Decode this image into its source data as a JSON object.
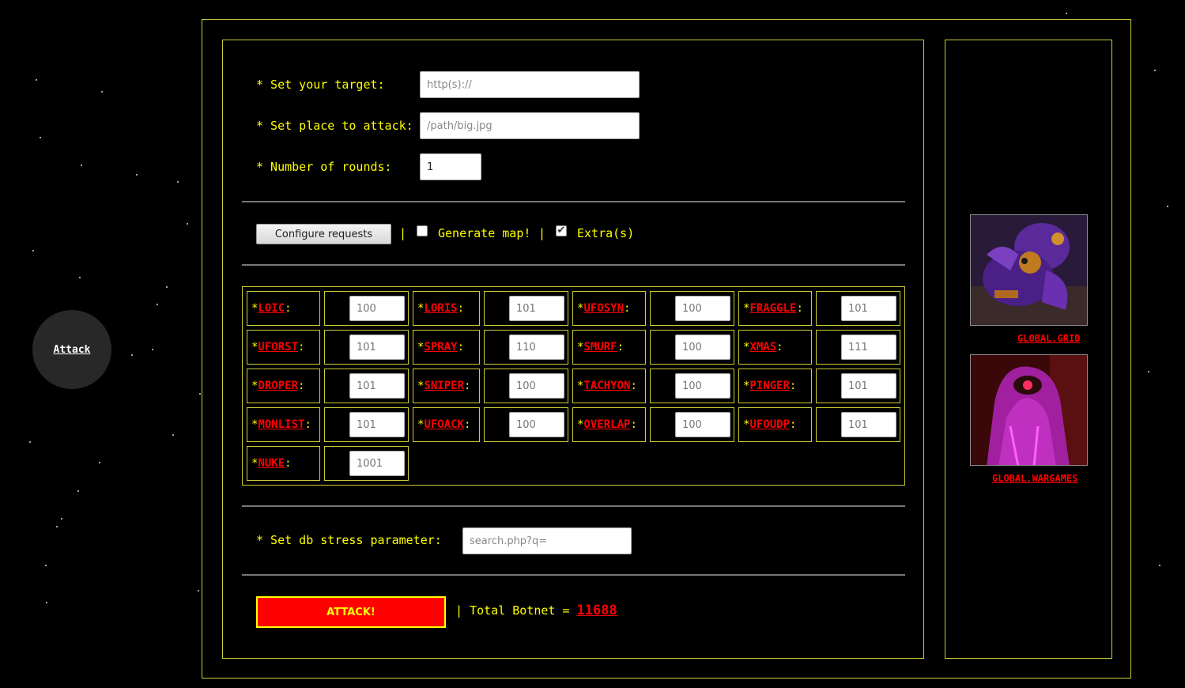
{
  "nav": {
    "attack_label": "Attack"
  },
  "form": {
    "target_label": "* Set your target:",
    "target_placeholder": "http(s)://",
    "place_label": "* Set place to attack:",
    "place_placeholder": "/path/big.jpg",
    "rounds_label": "* Number of rounds:",
    "rounds_value": "1"
  },
  "options": {
    "configure_label": "Configure requests",
    "separator": "|",
    "generate_map_label": "Generate map!",
    "generate_map_checked": false,
    "extras_label": "Extra(s)",
    "extras_checked": true
  },
  "extras": [
    {
      "name": "LOIC",
      "value": "100"
    },
    {
      "name": "LORIS",
      "value": "101"
    },
    {
      "name": "UFOSYN",
      "value": "100"
    },
    {
      "name": "FRAGGLE",
      "value": "101"
    },
    {
      "name": "UFORST",
      "value": "101"
    },
    {
      "name": "SPRAY",
      "value": "110"
    },
    {
      "name": "SMURF",
      "value": "100"
    },
    {
      "name": "XMAS",
      "value": "111"
    },
    {
      "name": "DROPER",
      "value": "101"
    },
    {
      "name": "SNIPER",
      "value": "100"
    },
    {
      "name": "TACHYON",
      "value": "100"
    },
    {
      "name": "PINGER",
      "value": "101"
    },
    {
      "name": "MONLIST",
      "value": "101"
    },
    {
      "name": "UFOACK",
      "value": "100"
    },
    {
      "name": "OVERLAP",
      "value": "100"
    },
    {
      "name": "UFOUDP",
      "value": "101"
    },
    {
      "name": "NUKE",
      "value": "1001"
    }
  ],
  "db_stress": {
    "label": "* Set db stress parameter:",
    "placeholder": "search.php?q="
  },
  "attack": {
    "button_label": "ATTACK!",
    "total_prefix": "| Total Botnet =",
    "total_value": "11688"
  },
  "side": {
    "grid_label": "GLOBAL.GRID",
    "wargames_label": "GLOBAL.WARGAMES"
  },
  "colors": {
    "accent": "#ffff00",
    "link": "#ff0000",
    "border": "#cccc33"
  }
}
